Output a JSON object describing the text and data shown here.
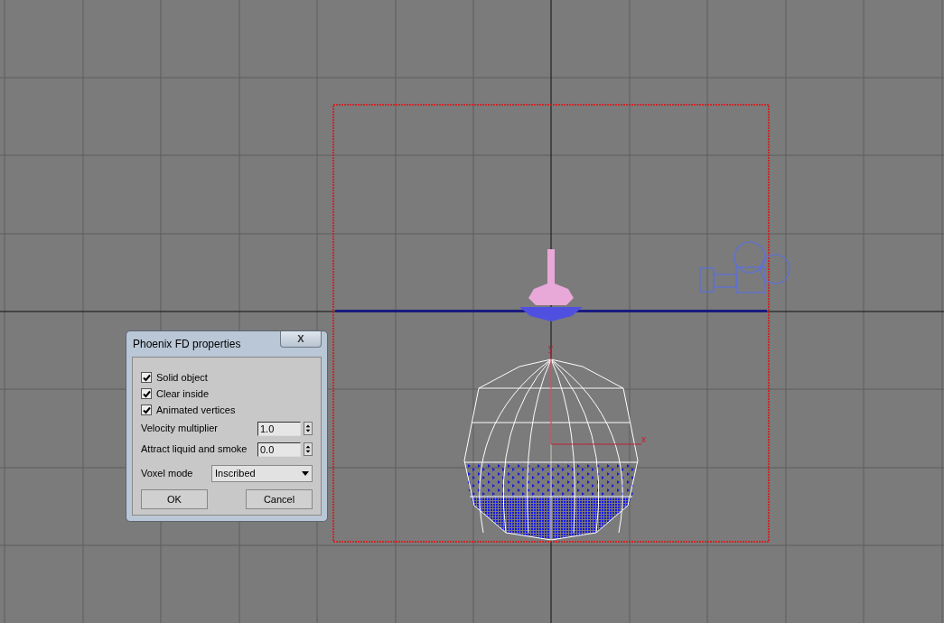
{
  "viewport": {
    "axis_labels": [
      {
        "text": "y",
        "kind": "y"
      },
      {
        "text": "x",
        "kind": "x"
      }
    ]
  },
  "dialog": {
    "title": "Phoenix FD properties",
    "close": "X",
    "checkboxes": [
      {
        "label": "Solid object",
        "checked": true
      },
      {
        "label": "Clear inside",
        "checked": true
      },
      {
        "label": "Animated vertices",
        "checked": true
      }
    ],
    "spinners": [
      {
        "label": "Velocity multiplier",
        "value": "1.0"
      },
      {
        "label": "Attract liquid and smoke",
        "value": "0.0"
      }
    ],
    "dropdown": {
      "label": "Voxel mode",
      "value": "Inscribed"
    },
    "buttons": [
      "OK",
      "Cancel"
    ]
  }
}
